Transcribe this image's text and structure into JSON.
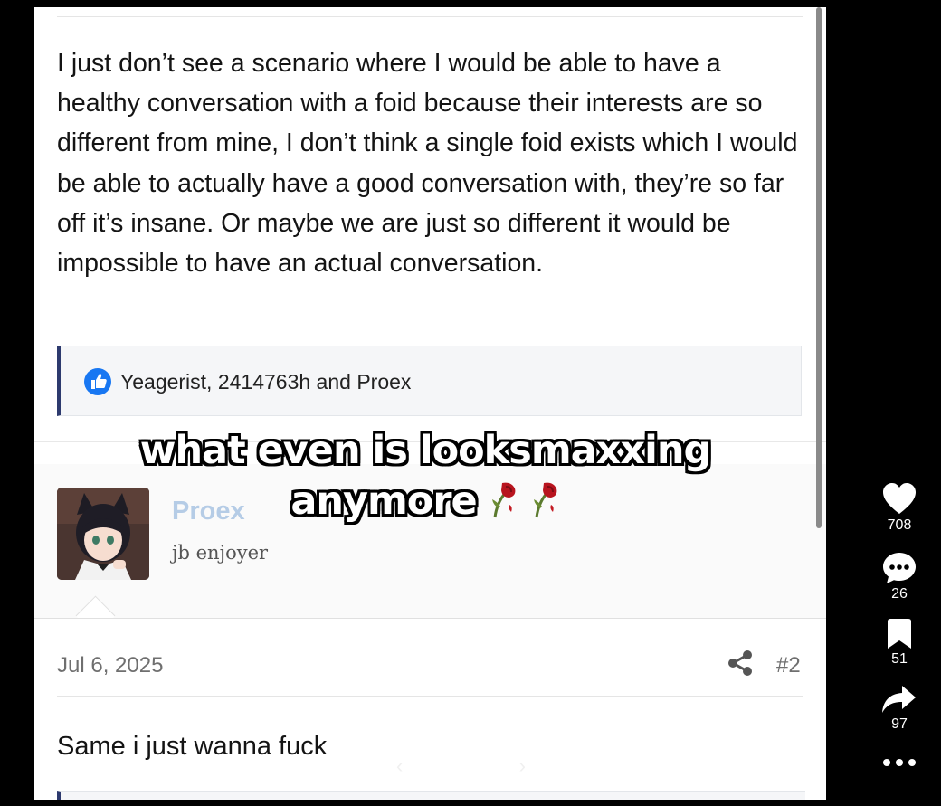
{
  "post": {
    "body": "I just don’t see a scenario where I would be able to have a healthy conversation with a foid because their interests are so different from mine, I don’t think a single foid exists which I would be able to actually have a good conversation with, they’re so far off it’s insane. Or maybe we are just so different it would be impossible to have an actual conversation.",
    "reactions": "Yeagerist, 2414763h and Proex"
  },
  "reply": {
    "username": "Proex",
    "user_title": "jb enjoyer",
    "date": "Jul 6, 2025",
    "post_number": "#2",
    "body": "Same i just wanna fuck"
  },
  "overlay": {
    "line1": "what even is looksmaxxing",
    "line2": "anymore"
  },
  "actions": {
    "likes": "708",
    "comments": "26",
    "bookmarks": "51",
    "shares": "97"
  },
  "colors": {
    "accent": "#2d3a6e",
    "like_blue": "#1877f2",
    "username": "#b5cce6"
  },
  "icons": [
    "like-reaction-icon",
    "share-icon",
    "heart-icon",
    "comment-icon",
    "bookmark-icon",
    "forward-icon",
    "more-icon",
    "wilted-rose-emoji"
  ]
}
